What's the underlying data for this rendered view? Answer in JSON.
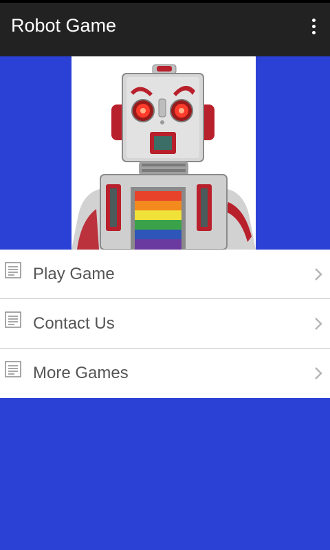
{
  "app": {
    "title": "Robot Game",
    "overflow_icon": "more-vert-icon",
    "colors": {
      "action_bar": "#222222",
      "background": "#2b41d6",
      "list_background": "#ffffff",
      "label_text": "#555555"
    }
  },
  "hero": {
    "image": "robot-illustration"
  },
  "menu": {
    "items": [
      {
        "label": "Play Game",
        "icon": "document-icon",
        "trailing_icon": "chevron-right-icon"
      },
      {
        "label": "Contact Us",
        "icon": "document-icon",
        "trailing_icon": "chevron-right-icon"
      },
      {
        "label": "More Games",
        "icon": "document-icon",
        "trailing_icon": "chevron-right-icon"
      }
    ]
  }
}
